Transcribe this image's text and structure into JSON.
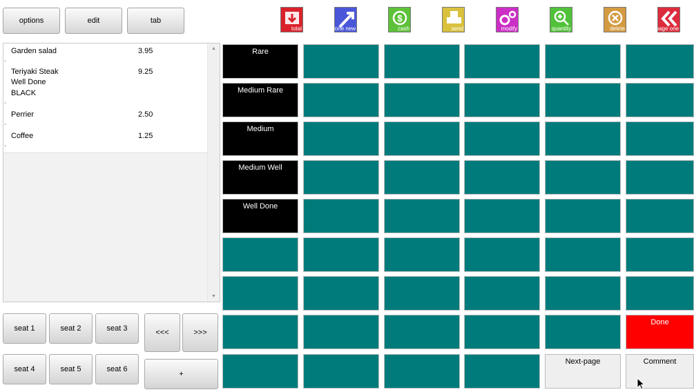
{
  "top_buttons": {
    "options": "options",
    "edit": "edit",
    "tab": "tab"
  },
  "toolbar": [
    {
      "label": "total",
      "icon": "total-arrow-down-icon",
      "color": "#d9222b"
    },
    {
      "label": "done new",
      "icon": "done-new-arrow-icon",
      "color": "#4a56d8"
    },
    {
      "label": "cash",
      "icon": "cash-dollar-icon",
      "color": "#5ec13a"
    },
    {
      "label": "send",
      "icon": "send-printer-icon",
      "color": "#d9c13e"
    },
    {
      "label": "modify",
      "icon": "modify-gear-icon",
      "color": "#cc2fc6"
    },
    {
      "label": "quantity",
      "icon": "quantity-magnifier-icon",
      "color": "#52c13a"
    },
    {
      "label": "delete",
      "icon": "delete-x-icon",
      "color": "#d39a42"
    },
    {
      "label": "page one",
      "icon": "page-one-rewind-icon",
      "color": "#dd2c3c"
    }
  ],
  "order": {
    "items": [
      {
        "name": "Garden salad",
        "price": "3.95"
      },
      {
        "name": "Teriyaki Steak",
        "price": "9.25",
        "mods": [
          "Well Done",
          "BLACK"
        ]
      },
      {
        "name": "Perrier",
        "price": "2.50"
      },
      {
        "name": "Coffee",
        "price": "1.25"
      }
    ]
  },
  "seats": {
    "seat1": "seat 1",
    "seat2": "seat 2",
    "seat3": "seat 3",
    "seat4": "seat 4",
    "seat5": "seat 5",
    "seat6": "seat 6",
    "prev": "<<<",
    "next": ">>>",
    "plus": "+"
  },
  "grid": {
    "modifiers": [
      "Rare",
      "Medium Rare",
      "Medium",
      "Medium Well",
      "Well Done"
    ],
    "done": "Done",
    "next_page": "Next-page",
    "comment": "Comment",
    "colors": {
      "teal": "#007b7b",
      "black": "#000000",
      "red": "#ff0000",
      "gray": "#efefef"
    }
  }
}
